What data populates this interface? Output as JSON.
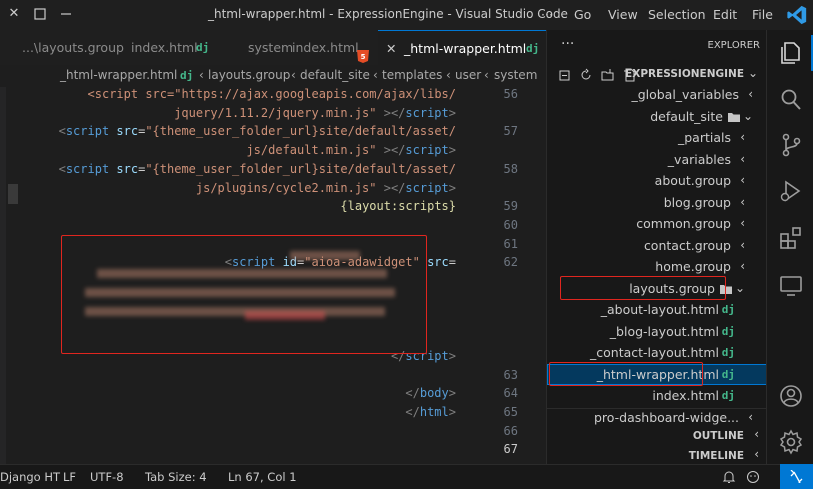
{
  "titlebar": {
    "title": "_html-wrapper.html - ExpressionEngine - Visual Studio Code",
    "menu": [
      "File",
      "Edit",
      "Selection",
      "View",
      "Go",
      "···"
    ]
  },
  "tabs": [
    {
      "icon": "dj",
      "label": "_html-wrapper.html",
      "active": true,
      "close": "✕"
    },
    {
      "icon": "html5",
      "label": "index.html",
      "suffix": "system",
      "active": false
    },
    {
      "icon": "dj",
      "label": "index.html",
      "suffix": "...\\layouts.group",
      "active": false
    }
  ],
  "breadcrumb": {
    "parts": [
      "system",
      "user",
      "templates",
      "default_site",
      "layouts.group"
    ],
    "file": "_html-wrapper.html"
  },
  "editor": {
    "lines": [
      {
        "num": "56",
        "segs": [
          {
            "t": "<script src=\"https://ajax.googleapis.com/ajax/libs/",
            "c": "str"
          }
        ]
      },
      {
        "num": "",
        "segs": [
          {
            "t": "jquery/1.11.2/jquery.min.js\"",
            "c": "str"
          },
          {
            "t": " ></",
            "c": "brk"
          },
          {
            "t": "script",
            "c": "tag"
          },
          {
            "t": ">",
            "c": "brk"
          }
        ]
      },
      {
        "num": "57",
        "segs": [
          {
            "t": "<",
            "c": "brk"
          },
          {
            "t": "script",
            "c": "tag"
          },
          {
            "t": " src",
            "c": "attr"
          },
          {
            "t": "=",
            "c": "pun"
          },
          {
            "t": "\"{theme_user_folder_url}site/default/asset/",
            "c": "str"
          }
        ]
      },
      {
        "num": "",
        "segs": [
          {
            "t": "js/default.min.js\"",
            "c": "str"
          },
          {
            "t": " ></",
            "c": "brk"
          },
          {
            "t": "script",
            "c": "tag"
          },
          {
            "t": ">",
            "c": "brk"
          }
        ]
      },
      {
        "num": "58",
        "segs": [
          {
            "t": "<",
            "c": "brk"
          },
          {
            "t": "script",
            "c": "tag"
          },
          {
            "t": " src",
            "c": "attr"
          },
          {
            "t": "=",
            "c": "pun"
          },
          {
            "t": "\"{theme_user_folder_url}site/default/asset/",
            "c": "str"
          }
        ]
      },
      {
        "num": "",
        "segs": [
          {
            "t": "js/plugins/cycle2.min.js\"",
            "c": "str"
          },
          {
            "t": " ></",
            "c": "brk"
          },
          {
            "t": "script",
            "c": "tag"
          },
          {
            "t": ">",
            "c": "brk"
          }
        ]
      },
      {
        "num": "59",
        "segs": [
          {
            "t": "{layout:scripts}",
            "c": "tpl"
          }
        ]
      },
      {
        "num": "60",
        "segs": []
      },
      {
        "num": "61",
        "segs": []
      },
      {
        "num": "62",
        "segs": [
          {
            "t": "<",
            "c": "brk"
          },
          {
            "t": "script",
            "c": "tag"
          },
          {
            "t": " id",
            "c": "attr"
          },
          {
            "t": "=",
            "c": "pun"
          },
          {
            "t": "\"aioa-adawidget\"",
            "c": "str"
          },
          {
            "t": " src",
            "c": "attr"
          },
          {
            "t": "=",
            "c": "pun"
          }
        ]
      },
      {
        "num": "",
        "segs": []
      },
      {
        "num": "",
        "segs": []
      },
      {
        "num": "",
        "segs": []
      },
      {
        "num": "",
        "segs": []
      },
      {
        "num": "",
        "segs": [
          {
            "t": "</",
            "c": "brk"
          },
          {
            "t": "script",
            "c": "tag"
          },
          {
            "t": ">",
            "c": "brk"
          }
        ]
      },
      {
        "num": "63",
        "segs": []
      },
      {
        "num": "64",
        "segs": [
          {
            "t": "</",
            "c": "brk"
          },
          {
            "t": "body",
            "c": "tag"
          },
          {
            "t": ">",
            "c": "brk"
          }
        ]
      },
      {
        "num": "65",
        "segs": [
          {
            "t": "</",
            "c": "brk"
          },
          {
            "t": "html",
            "c": "tag"
          },
          {
            "t": ">",
            "c": "brk"
          }
        ]
      },
      {
        "num": "66",
        "segs": []
      },
      {
        "num": "67",
        "segs": []
      }
    ]
  },
  "explorer": {
    "header": "EXPLORER",
    "root": "EXPRESSIONENGINE",
    "items": [
      {
        "label": "_global_variables",
        "kind": "folder",
        "chev": "›"
      },
      {
        "label": "default_site",
        "kind": "folder-open",
        "chev": "⌄"
      },
      {
        "label": "_partials",
        "kind": "folder",
        "chev": "›"
      },
      {
        "label": "_variables",
        "kind": "folder",
        "chev": "›"
      },
      {
        "label": "about.group",
        "kind": "folder",
        "chev": "›"
      },
      {
        "label": "blog.group",
        "kind": "folder",
        "chev": "›"
      },
      {
        "label": "common.group",
        "kind": "folder",
        "chev": "›"
      },
      {
        "label": "contact.group",
        "kind": "folder",
        "chev": "›"
      },
      {
        "label": "home.group",
        "kind": "folder",
        "chev": "›"
      },
      {
        "label": "layouts.group",
        "kind": "folder-open",
        "chev": "⌄",
        "highlight": true
      },
      {
        "label": "_about-layout.html",
        "kind": "dj"
      },
      {
        "label": "_blog-layout.html",
        "kind": "dj"
      },
      {
        "label": "_contact-layout.html",
        "kind": "dj"
      },
      {
        "label": "_html-wrapper.html",
        "kind": "dj",
        "selected": true,
        "highlight": true
      },
      {
        "label": "index.html",
        "kind": "dj"
      },
      {
        "label": "pro-dashboard-widge...",
        "kind": "folder",
        "chev": "›"
      }
    ],
    "outline": "OUTLINE",
    "timeline": "TIMELINE"
  },
  "status": {
    "position": "Ln 67, Col 1",
    "tab_size": "Tab Size: 4",
    "encoding": "UTF-8",
    "eol": "LF",
    "language": "Django HT"
  },
  "colors": {
    "highlight": "#e0261f",
    "accent": "#0078d4",
    "dj": "#44b78b"
  }
}
